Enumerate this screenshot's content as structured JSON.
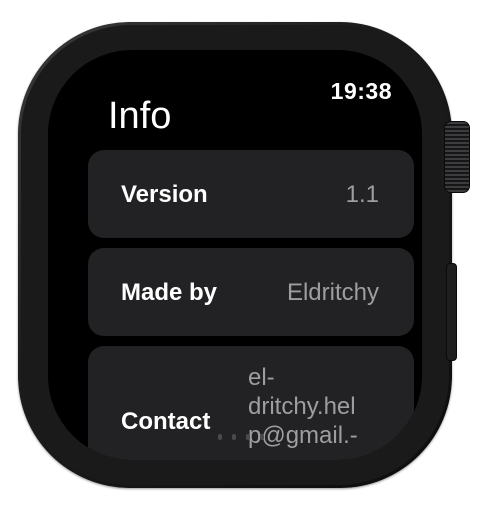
{
  "status_bar": {
    "time": "19:38"
  },
  "page": {
    "title": "Info"
  },
  "rows": [
    {
      "label": "Version",
      "value": "1.1"
    },
    {
      "label": "Made by",
      "value": "Eldritchy"
    },
    {
      "label": "Contact",
      "value": "el-\ndritchy.hel\np@gmail.-"
    }
  ],
  "colors": {
    "screen_background": "#000000",
    "row_background": "#222224",
    "label_text": "#ffffff",
    "value_text": "#9d9da2"
  }
}
